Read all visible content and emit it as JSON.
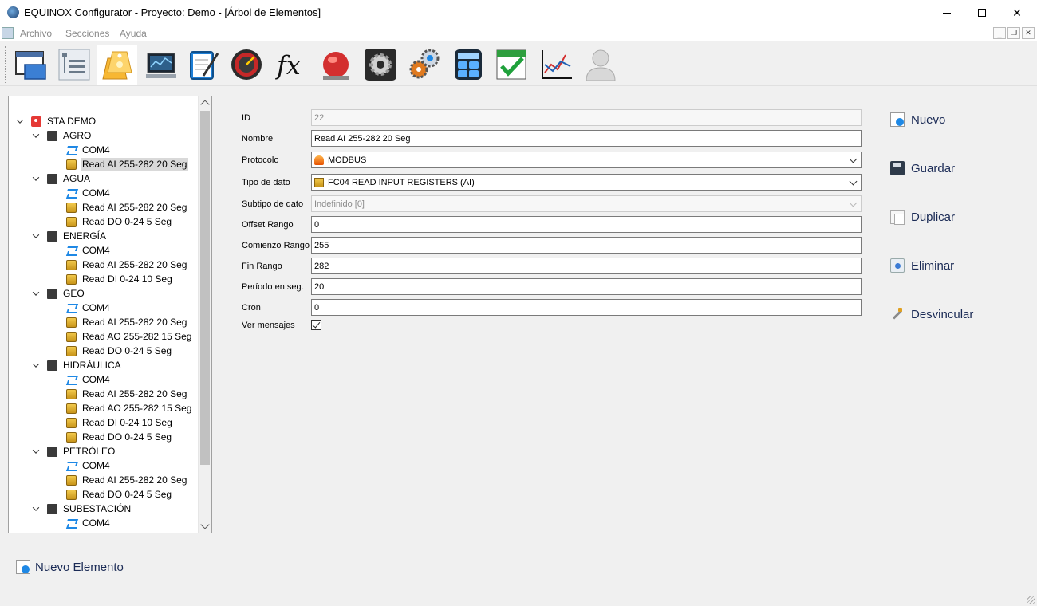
{
  "window": {
    "title": "EQUINOX Configurator - Proyecto: Demo - [Árbol de Elementos]",
    "controls": {
      "minimize": "minimize-icon",
      "maximize": "maximize-icon",
      "close": "✕"
    }
  },
  "menu": {
    "items": [
      "Archivo",
      "Secciones",
      "Ayuda"
    ]
  },
  "toolbar": {
    "buttons": [
      {
        "icon": "window-icon"
      },
      {
        "icon": "tree-icon"
      },
      {
        "icon": "tags-icon"
      },
      {
        "icon": "monitor-icon"
      },
      {
        "icon": "notepad-icon"
      },
      {
        "icon": "gauge-icon"
      },
      {
        "icon": "function-icon",
        "text": "fx"
      },
      {
        "icon": "alarm-bell-icon"
      },
      {
        "icon": "gear-icon"
      },
      {
        "icon": "gears-icon"
      },
      {
        "icon": "calculator-icon"
      },
      {
        "icon": "calendar-check-icon"
      },
      {
        "icon": "line-chart-icon"
      },
      {
        "icon": "user-icon"
      }
    ]
  },
  "tree": {
    "rows": [
      {
        "label": "STA DEMO",
        "type": "root",
        "level": 0,
        "expanded": true
      },
      {
        "label": "AGRO",
        "type": "group",
        "level": 1,
        "expanded": true
      },
      {
        "label": "COM4",
        "type": "com",
        "level": 2
      },
      {
        "label": "Read AI 255-282 20 Seg",
        "type": "read",
        "level": 2,
        "selected": true
      },
      {
        "label": "AGUA",
        "type": "group",
        "level": 1,
        "expanded": true
      },
      {
        "label": "COM4",
        "type": "com",
        "level": 2
      },
      {
        "label": "Read AI 255-282 20 Seg",
        "type": "read",
        "level": 2
      },
      {
        "label": "Read DO 0-24 5 Seg",
        "type": "read",
        "level": 2
      },
      {
        "label": "ENERGÍA",
        "type": "group",
        "level": 1,
        "expanded": true
      },
      {
        "label": "COM4",
        "type": "com",
        "level": 2
      },
      {
        "label": "Read AI 255-282 20 Seg",
        "type": "read",
        "level": 2
      },
      {
        "label": "Read DI 0-24 10 Seg",
        "type": "read",
        "level": 2
      },
      {
        "label": "GEO",
        "type": "group",
        "level": 1,
        "expanded": true
      },
      {
        "label": "COM4",
        "type": "com",
        "level": 2
      },
      {
        "label": "Read AI 255-282 20 Seg",
        "type": "read",
        "level": 2
      },
      {
        "label": "Read AO 255-282 15 Seg",
        "type": "read",
        "level": 2
      },
      {
        "label": "Read DO 0-24 5 Seg",
        "type": "read",
        "level": 2
      },
      {
        "label": "HIDRÁULICA",
        "type": "group",
        "level": 1,
        "expanded": true
      },
      {
        "label": "COM4",
        "type": "com",
        "level": 2
      },
      {
        "label": "Read AI 255-282 20 Seg",
        "type": "read",
        "level": 2
      },
      {
        "label": "Read AO 255-282 15 Seg",
        "type": "read",
        "level": 2
      },
      {
        "label": "Read DI 0-24 10 Seg",
        "type": "read",
        "level": 2
      },
      {
        "label": "Read DO 0-24 5 Seg",
        "type": "read",
        "level": 2
      },
      {
        "label": "PETRÓLEO",
        "type": "group",
        "level": 1,
        "expanded": true
      },
      {
        "label": "COM4",
        "type": "com",
        "level": 2
      },
      {
        "label": "Read AI 255-282 20 Seg",
        "type": "read",
        "level": 2
      },
      {
        "label": "Read DO 0-24 5 Seg",
        "type": "read",
        "level": 2
      },
      {
        "label": "SUBESTACIÓN",
        "type": "group",
        "level": 1,
        "expanded": true
      },
      {
        "label": "COM4",
        "type": "com",
        "level": 2
      }
    ]
  },
  "form": {
    "id": {
      "label": "ID",
      "value": "22"
    },
    "nombre": {
      "label": "Nombre",
      "value": "Read AI 255-282 20 Seg"
    },
    "protocolo": {
      "label": "Protocolo",
      "value": "MODBUS"
    },
    "tipo_dato": {
      "label": "Tipo de dato",
      "value": "FC04 READ INPUT REGISTERS (AI)"
    },
    "subtipo_dato": {
      "label": "Subtipo de dato",
      "value": "Indefinido [0]"
    },
    "offset_rango": {
      "label": "Offset Rango",
      "value": "0"
    },
    "comienzo_rango": {
      "label": "Comienzo Rango",
      "value": "255"
    },
    "fin_rango": {
      "label": "Fin Rango",
      "value": "282"
    },
    "periodo": {
      "label": "Período en seg.",
      "value": "20"
    },
    "cron": {
      "label": "Cron",
      "value": "0"
    },
    "ver_mensajes": {
      "label": "Ver mensajes",
      "checked": true
    }
  },
  "actions": {
    "nuevo": "Nuevo",
    "guardar": "Guardar",
    "duplicar": "Duplicar",
    "eliminar": "Eliminar",
    "desvincular": "Desvincular"
  },
  "footer": {
    "nuevo_elemento": "Nuevo Elemento"
  },
  "colors": {
    "accent_text": "#1a2a55",
    "selection": "#d9d9d9",
    "root_pin": "#e53935"
  }
}
